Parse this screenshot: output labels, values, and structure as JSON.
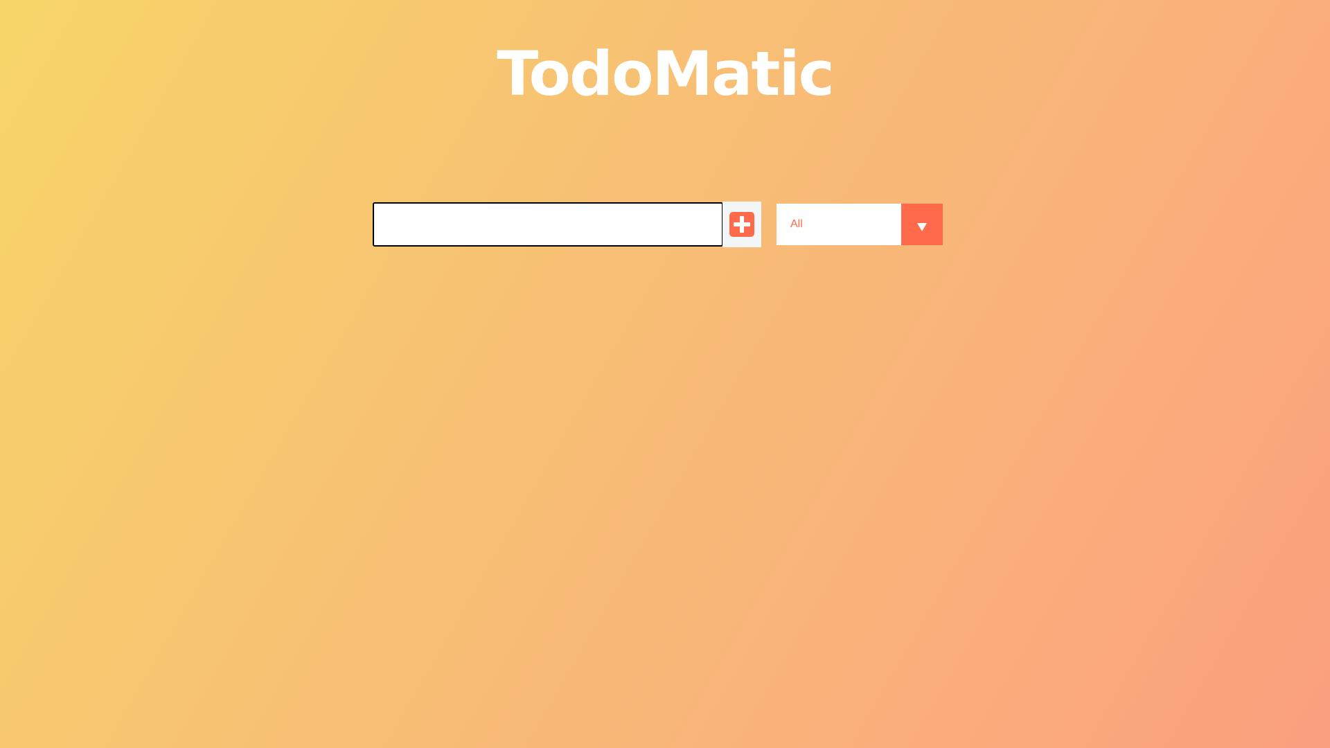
{
  "app": {
    "title": "TodoMatic"
  },
  "new_todo": {
    "value": "",
    "placeholder": "",
    "add_icon": "plus-square-icon"
  },
  "filter": {
    "selected": "All",
    "arrow_icon": "chevron-down-icon"
  },
  "colors": {
    "accent": "#ff6b4a",
    "gradient_start": "#f7d568",
    "gradient_end": "#fb9f7e",
    "title": "#ffffff"
  }
}
